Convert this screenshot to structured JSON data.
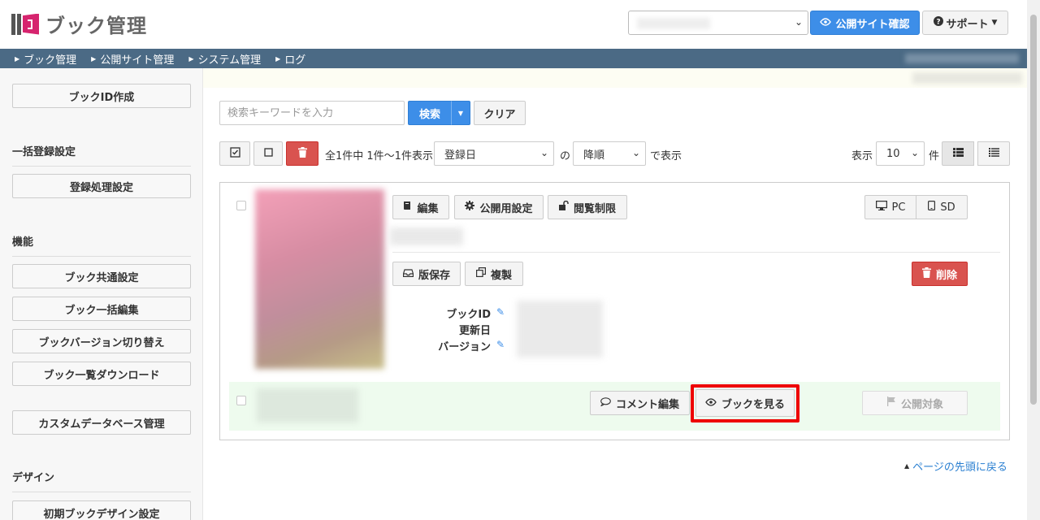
{
  "app": {
    "title": "ブック管理"
  },
  "header": {
    "site_select": {
      "value": ""
    },
    "public_site_button": "公開サイト確認",
    "support_button": "サポート"
  },
  "nav": {
    "items": [
      {
        "label": "ブック管理"
      },
      {
        "label": "公開サイト管理"
      },
      {
        "label": "システム管理"
      },
      {
        "label": "ログ"
      }
    ]
  },
  "sidebar": {
    "create_book_id": "ブックID作成",
    "bulk_heading": "一括登録設定",
    "registration_settings": "登録処理設定",
    "features_heading": "機能",
    "features": [
      {
        "label": "ブック共通設定"
      },
      {
        "label": "ブック一括編集"
      },
      {
        "label": "ブックバージョン切り替え"
      },
      {
        "label": "ブック一覧ダウンロード"
      },
      {
        "label": "カスタムデータベース管理"
      }
    ],
    "design_heading": "デザイン",
    "initial_design": "初期ブックデザイン設定"
  },
  "search": {
    "placeholder": "検索キーワードを入力",
    "search_button": "検索",
    "clear_button": "クリア"
  },
  "toolbar": {
    "summary": "全1件中 1件〜1件表示",
    "sort_field": "登録日",
    "of_text": "の",
    "sort_order": "降順",
    "display_suffix": "で表示",
    "display_label": "表示",
    "per_page": "10",
    "count_unit": "件"
  },
  "book": {
    "edit_button": "編集",
    "publish_settings_button": "公開用設定",
    "access_restriction_button": "閲覧制限",
    "pc_button": "PC",
    "sd_button": "SD",
    "save_version_button": "版保存",
    "duplicate_button": "複製",
    "delete_button": "削除",
    "meta": {
      "book_id_label": "ブックID",
      "updated_label": "更新日",
      "version_label": "バージョン"
    },
    "comment_edit_button": "コメント編集",
    "view_book_button": "ブックを見る",
    "public_target_button": "公開対象"
  },
  "back_to_top": "ページの先頭に戻る",
  "colors": {
    "primary": "#3d8ee8",
    "navbar": "#4b6a85",
    "danger": "#d9534f",
    "highlight": "#ee0000",
    "logo_accent": "#d6246e"
  }
}
